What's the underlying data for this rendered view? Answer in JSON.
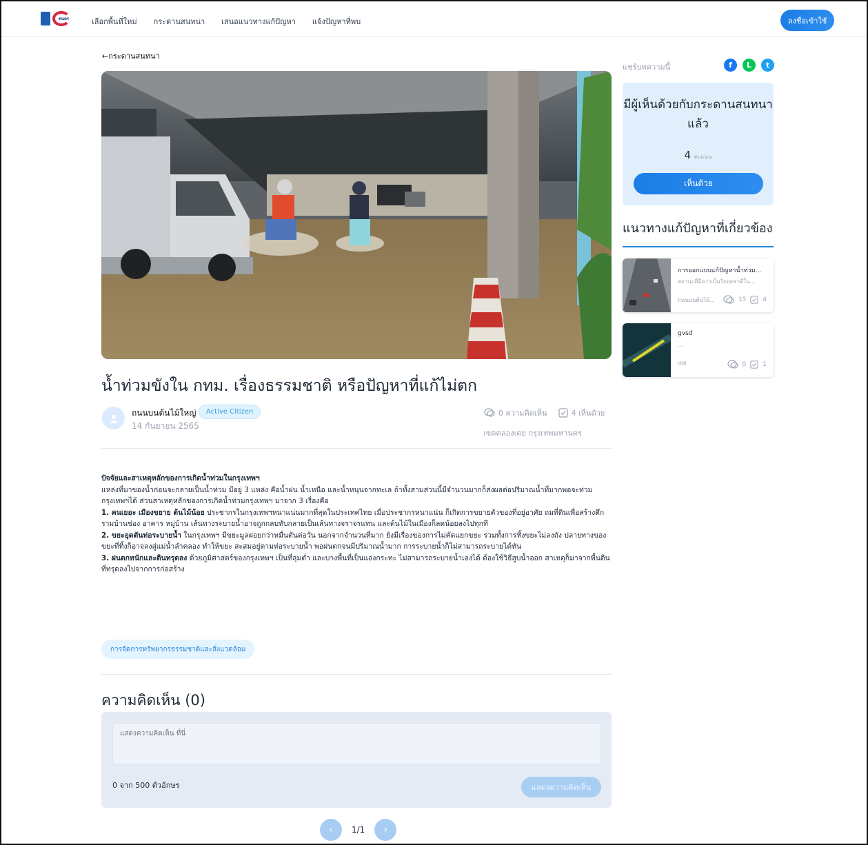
{
  "header": {
    "logo_text": "ดนตร",
    "nav": [
      "เลือกพื้นที่ใหม่",
      "กระดานสนทนา",
      "เสนอแนวทางแก้ปัญหา",
      "แจ้งปัญหาที่พบ"
    ],
    "login_label": "ลงชื่อเข้าใช้"
  },
  "back_label": "←กระดานสนทนา",
  "post": {
    "title": "น้ำท่วมขังใน กทม. เรื่องธรรมชาติ หรือปัญหาที่แก้ไม่ตก",
    "author": "ถนนบนต้นไม้ใหญ่",
    "badge": "Active Citizen",
    "date": "14 กันยายน 2565",
    "comments_stat": "0 ความคิดเห็น",
    "agree_stat": "4 เห็นด้วย",
    "location": "เขตคลองเตย  กรุงเทพมหานคร",
    "body": {
      "heading": "ปัจจัยและสาเหตุหลักของการเกิดน้ำท่วมในกรุงเทพฯ",
      "intro": "แหล่งที่มาของน้ำก่อนจะกลายเป็นน้ำท่วม มีอยู่ 3 แหล่ง คือน้ำฝน น้ำเหนือ และน้ำหนุนจากทะเล ถ้าทั้งสามส่วนนี้มีจำนวนมากก็ส่งผลต่อปริมาณน้ำที่มากพอจะท่วมกรุงเทพฯได้ ส่วนสาเหตุหลักของการเกิดน้ำท่วมกรุงเทพฯ มาจาก 3 เรื่องคือ",
      "p1_bold": "1. คนเยอะ เมืองขยาย ต้นไม้น้อย",
      "p1": " ประชากรในกรุงเทพฯหนาแน่นมากที่สุดในประเทศไทย เมื่อประชากรหนาแน่น ก็เกิดการขยายตัวของที่อยู่อาศัย ถมที่ดินเพื่อสร้างตึกรามบ้านช่อง อาคาร หมู่บ้าน เส้นทางระบายน้ำอาจถูกกลบทับกลายเป็นเส้นทางจราจรแทน และต้นไม้ในเมืองก็ลดน้อยลงไปทุกที",
      "p2_bold": "2. ขยะอุดตันท่อระบายน้ำ",
      "p2": " ในกรุงเทพฯ มีขยะมูลฝอยกว่าหมื่นตันต่อวัน นอกจากจำนวนที่มาก ยังมีเรื่องของการไม่คัดแยกขยะ รวมทั้งการทิ้งขยะไม่ลงถัง ปลายทางของขยะที่ทิ้งก็อาจลงสู่แม่น้ำลำคลอง ทำให้ขยะ สะสมอยู่ตามท่อระบายน้ำ พอฝนตกจนมีปริมาณน้ำมาก การระบายน้ำก็ไม่สามารถระบายได้ทัน",
      "p3_bold": "3. ฝนตกหนักและดินทรุดลง",
      "p3": " ด้วยภูมิศาสตร์ของกรุงเทพฯ เป็นที่ลุ่มต่ำ และบางพื้นที่เป็นแอ่งกระทะ ไม่สามารถระบายน้ำเองได้ ต้องใช้วิธีสูบน้ำออก สาเหตุก็มาจากพื้นดินที่ทรุดลงไปจากการก่อสร้าง"
    },
    "tag": "การจัดการทรัพยากรธรรมชาติและสิ่งแวดล้อม"
  },
  "comments": {
    "title": "ความคิดเห็น (0)",
    "placeholder": "แสดงความคิดเห็น ที่นี่",
    "char_count": "0 จาก 500 ตัวอักษร",
    "submit_label": "แสดงความคิดเห็น"
  },
  "pagination": {
    "prev": "‹",
    "page": "1/1",
    "next": "›"
  },
  "sidebar": {
    "share_label": "แชร์บทความนี้",
    "share_icons": [
      "f",
      "L",
      "t"
    ],
    "agree_title": "มีผู้เห็นด้วยกับกระดานสนทนาแล้ว",
    "agree_count": "4",
    "agree_unit": "คะแนน",
    "agree_button": "เห็นด้วย",
    "related_title": "แนวทางแก้ปัญหาที่เกี่ยวข้อง",
    "related": [
      {
        "title": "การออกแบบแก้ปัญหาน้ำท่วม...",
        "subtitle": "สถานะที่มีอว่าเป็นวิกฤตจาดีใน...",
        "author": "ถนนบนต้นไม้...",
        "comments": "15",
        "agrees": "4"
      },
      {
        "title": "gvsd",
        "subtitle": "...",
        "author": "ddl",
        "comments": "0",
        "agrees": "1"
      }
    ]
  },
  "colors": {
    "accent": "#1b7ee6",
    "facebook": "#1877f2",
    "line": "#06c755",
    "twitter": "#1da1f2"
  }
}
